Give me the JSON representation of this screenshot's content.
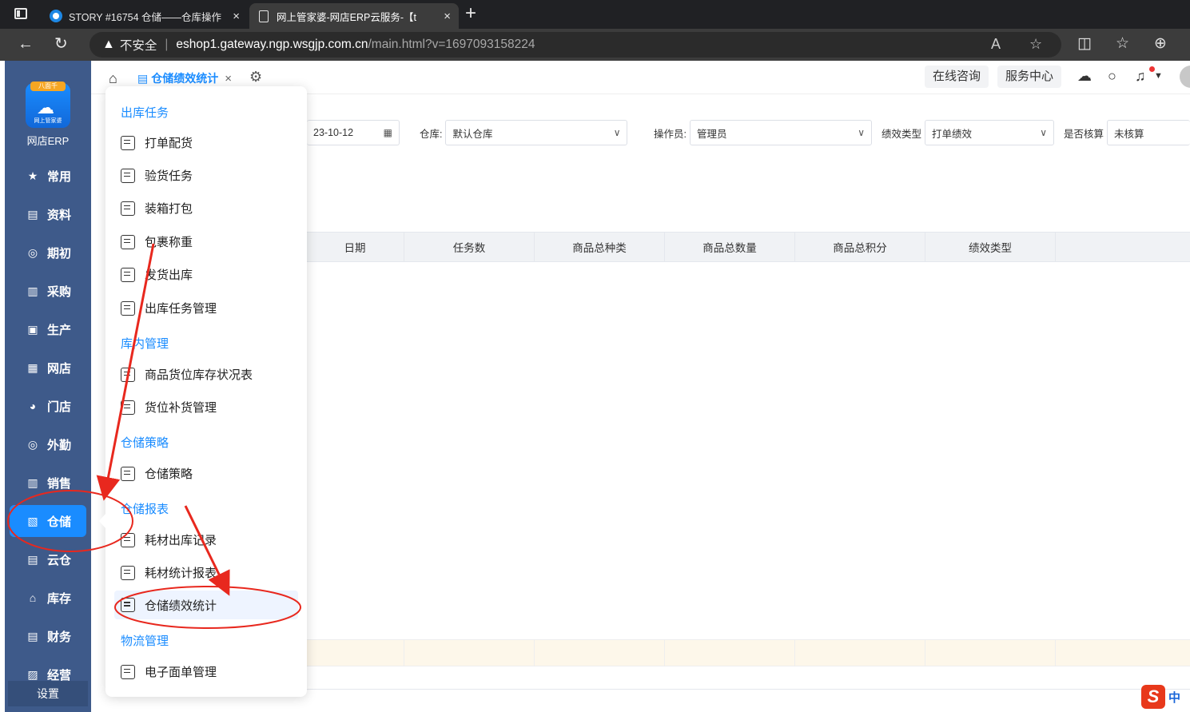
{
  "browser": {
    "tabs": [
      {
        "label": "STORY #16754 仓储——仓库操作",
        "close": "×"
      },
      {
        "label": "网上管家婆-网店ERP云服务-【t",
        "close": "×"
      }
    ],
    "new_tab": "+",
    "security_label": "不安全",
    "url_host": "eshop1.gateway.ngp.wsgjp.com.cn",
    "url_path": "/main.html?v=1697093158224"
  },
  "app": {
    "logo_badge": "八面千",
    "logo_sub": "网上管家婆",
    "name": "网店ERP",
    "sidebar": [
      {
        "label": "常用",
        "icon": "★"
      },
      {
        "label": "资料",
        "icon": "▤"
      },
      {
        "label": "期初",
        "icon": "◎"
      },
      {
        "label": "采购",
        "icon": "▥"
      },
      {
        "label": "生产",
        "icon": "▣"
      },
      {
        "label": "网店",
        "icon": "▦"
      },
      {
        "label": "门店",
        "icon": "◕"
      },
      {
        "label": "外勤",
        "icon": "◎"
      },
      {
        "label": "销售",
        "icon": "▥"
      },
      {
        "label": "仓储",
        "icon": "▧"
      },
      {
        "label": "云仓",
        "icon": "▤"
      },
      {
        "label": "库存",
        "icon": "⌂"
      },
      {
        "label": "财务",
        "icon": "▤"
      },
      {
        "label": "经营",
        "icon": "▨"
      }
    ],
    "settings_label": "设置"
  },
  "header": {
    "active_tab": "仓储绩效统计",
    "tab_close": "×",
    "consult_btn": "在线咨询",
    "service_btn": "服务中心"
  },
  "filters": {
    "date_value": "23-10-12",
    "warehouse_label": "仓库:",
    "warehouse_value": "默认仓库",
    "operator_label": "操作员:",
    "operator_value": "管理员",
    "perf_type_label": "绩效类型",
    "perf_type_value": "打单绩效",
    "audited_label": "是否核算",
    "audited_value": "未核算"
  },
  "table": {
    "columns": [
      "日期",
      "任务数",
      "商品总种类",
      "商品总数量",
      "商品总积分",
      "绩效类型"
    ]
  },
  "menu": {
    "sections": [
      {
        "title": "出库任务",
        "items": [
          "打单配货",
          "验货任务",
          "装箱打包",
          "包裹称重",
          "发货出库",
          "出库任务管理"
        ]
      },
      {
        "title": "库内管理",
        "items": [
          "商品货位库存状况表",
          "货位补货管理"
        ]
      },
      {
        "title": "仓储策略",
        "items": [
          "仓储策略"
        ]
      },
      {
        "title": "仓储报表",
        "items": [
          "耗材出库记录",
          "耗材统计报表",
          "仓储绩效统计"
        ]
      },
      {
        "title": "物流管理",
        "items": [
          "电子面单管理"
        ]
      }
    ]
  },
  "ime": {
    "logo": "S",
    "mode": "中"
  },
  "colors": {
    "accent": "#1a8cff",
    "sidebar": "#3e5a8a",
    "annotation": "#e8281e"
  }
}
